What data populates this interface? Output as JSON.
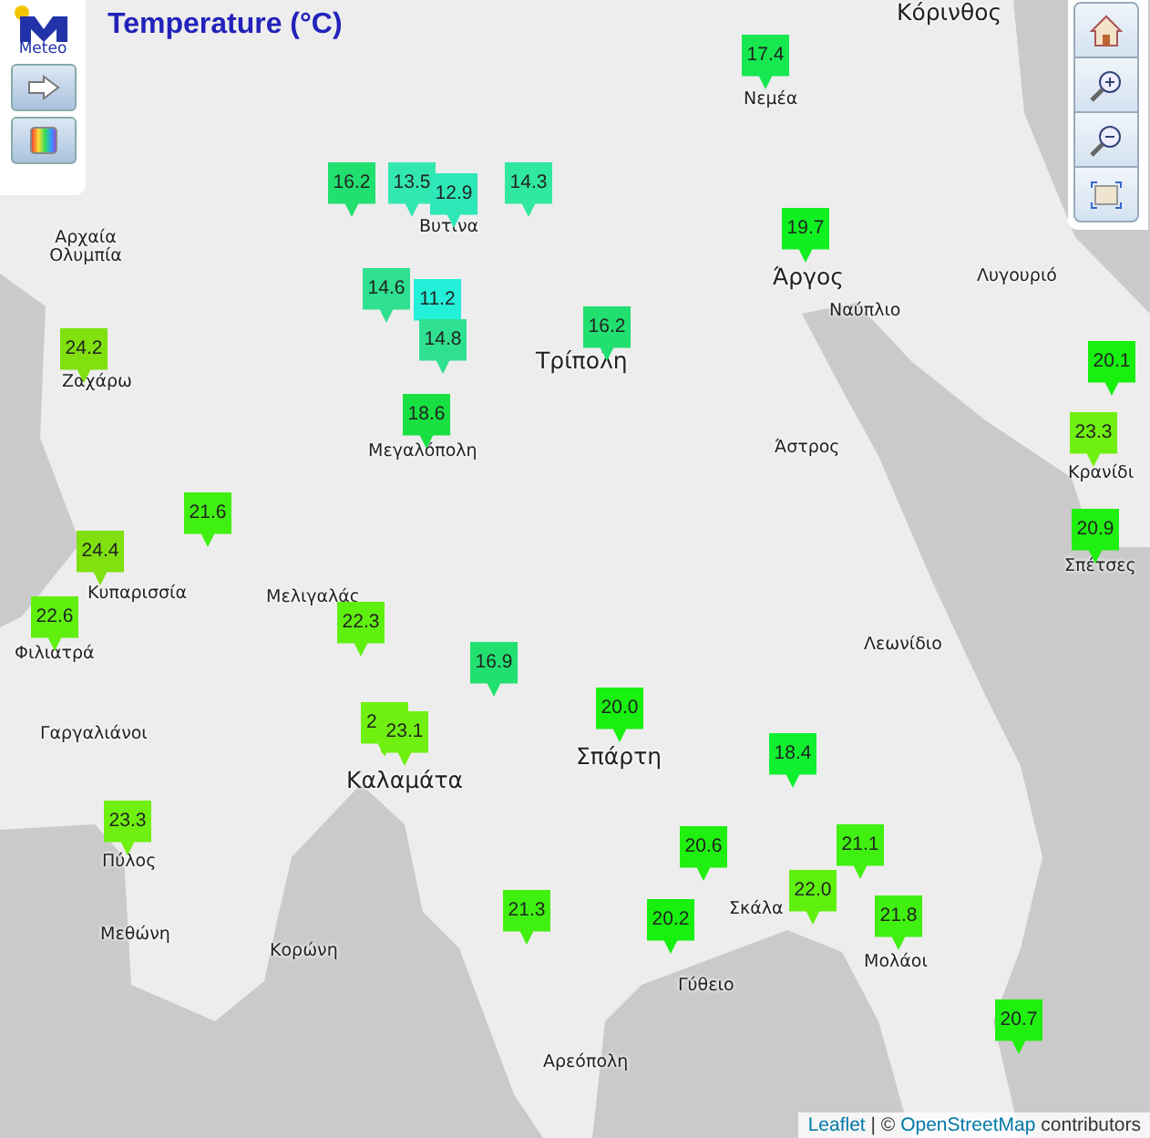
{
  "title": "Temperature (°C)",
  "logo": {
    "text": "Meteo"
  },
  "places": [
    {
      "name": "Κόρινθος",
      "kind": "major"
    },
    {
      "name": "Νεμέα",
      "kind": "minor"
    },
    {
      "name": "Αρχαία Ολυμπία",
      "kind": "minor"
    },
    {
      "name": "Βυτίνα",
      "kind": "minor"
    },
    {
      "name": "Τρίπολη",
      "kind": "major"
    },
    {
      "name": "Άργος",
      "kind": "major"
    },
    {
      "name": "Λυγουριό",
      "kind": "minor"
    },
    {
      "name": "Ναύπλιο",
      "kind": "minor"
    },
    {
      "name": "Ζαχάρω",
      "kind": "minor"
    },
    {
      "name": "Μεγαλόπολη",
      "kind": "minor"
    },
    {
      "name": "Άστρος",
      "kind": "minor"
    },
    {
      "name": "Κρανίδι",
      "kind": "minor"
    },
    {
      "name": "Σπέτσες",
      "kind": "minor"
    },
    {
      "name": "Κυπαρισσία",
      "kind": "minor"
    },
    {
      "name": "Φιλιατρά",
      "kind": "minor"
    },
    {
      "name": "Μελιγαλάς",
      "kind": "minor"
    },
    {
      "name": "Λεωνίδιο",
      "kind": "minor"
    },
    {
      "name": "Γαργαλιάνοι",
      "kind": "minor"
    },
    {
      "name": "Καλαμάτα",
      "kind": "major"
    },
    {
      "name": "Σπάρτη",
      "kind": "major"
    },
    {
      "name": "Πύλος",
      "kind": "minor"
    },
    {
      "name": "Μεθώνη",
      "kind": "minor"
    },
    {
      "name": "Κορώνη",
      "kind": "minor"
    },
    {
      "name": "Σκάλα",
      "kind": "minor"
    },
    {
      "name": "Μολάοι",
      "kind": "minor"
    },
    {
      "name": "Γύθειο",
      "kind": "minor"
    },
    {
      "name": "Αρεόπολη",
      "kind": "minor"
    }
  ],
  "markers": [
    {
      "value": "16.2",
      "color": "#22e070"
    },
    {
      "value": "13.5",
      "color": "#33e8b0"
    },
    {
      "value": "12.9",
      "color": "#2ee8b8"
    },
    {
      "value": "14.3",
      "color": "#30e8a0"
    },
    {
      "value": "14.6",
      "color": "#2ee090"
    },
    {
      "value": "11.2",
      "color": "#22f0d8"
    },
    {
      "value": "14.8",
      "color": "#2ee090"
    },
    {
      "value": "24.2",
      "color": "#80e010"
    },
    {
      "value": "17.4",
      "color": "#18e850"
    },
    {
      "value": "19.7",
      "color": "#10f020"
    },
    {
      "value": "16.2",
      "color": "#22e070"
    },
    {
      "value": "20.1",
      "color": "#18f010"
    },
    {
      "value": "18.6",
      "color": "#18e040"
    },
    {
      "value": "23.3",
      "color": "#70f010"
    },
    {
      "value": "20.9",
      "color": "#20f010"
    },
    {
      "value": "21.6",
      "color": "#40f010"
    },
    {
      "value": "24.4",
      "color": "#80e010"
    },
    {
      "value": "22.6",
      "color": "#60f010"
    },
    {
      "value": "22.3",
      "color": "#60f010"
    },
    {
      "value": "16.9",
      "color": "#22e070"
    },
    {
      "value": "20.0",
      "color": "#18f010"
    },
    {
      "value": "2",
      "color": "#70f010"
    },
    {
      "value": "23.1",
      "color": "#70f010"
    },
    {
      "value": "18.4",
      "color": "#10f030"
    },
    {
      "value": "23.3",
      "color": "#70f010"
    },
    {
      "value": "20.6",
      "color": "#20f010"
    },
    {
      "value": "21.1",
      "color": "#40f010"
    },
    {
      "value": "21.3",
      "color": "#40f010"
    },
    {
      "value": "20.2",
      "color": "#18f010"
    },
    {
      "value": "22.0",
      "color": "#60f010"
    },
    {
      "value": "21.8",
      "color": "#40f010"
    },
    {
      "value": "20.7",
      "color": "#20f010"
    }
  ],
  "attribution": {
    "link_1": "Leaflet",
    "separator": "| ©",
    "link_2": "OpenStreetMap",
    "suffix": "contributors"
  }
}
